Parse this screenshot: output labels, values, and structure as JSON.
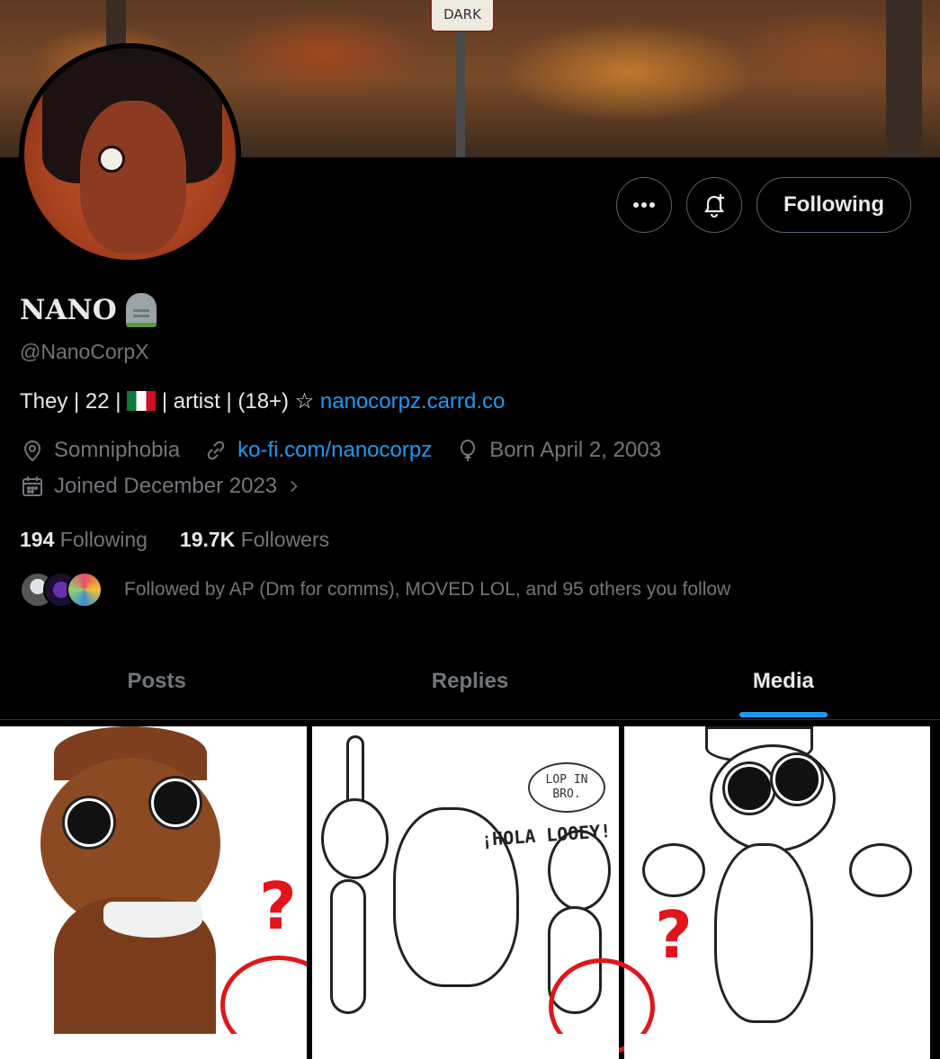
{
  "banner": {
    "sign_text": "DARK"
  },
  "actions": {
    "more_label": "•••",
    "notify_label": "Notifications",
    "follow_label": "Following"
  },
  "profile": {
    "name": "NANO",
    "name_emoji": "headstone",
    "handle": "@NanoCorpX",
    "bio_text": "They | 22 | ",
    "bio_flag": "Mexico flag",
    "bio_rest": " | artist | (18+) ☆ ",
    "bio_link": "nanocorpz.carrd.co",
    "location": "Somniphobia",
    "website": "ko-fi.com/nanocorpz",
    "birthday": "Born April 2, 2003",
    "joined": "Joined December 2023",
    "following_count": "194",
    "following_label": "Following",
    "followers_count": "19.7K",
    "followers_label": "Followers",
    "followed_by": "Followed by AP (Dm for comms), MOVED LOL, and 95 others you follow"
  },
  "tabs": [
    {
      "label": "Posts",
      "active": false
    },
    {
      "label": "Replies",
      "active": false
    },
    {
      "label": "Media",
      "active": true
    }
  ],
  "media": {
    "speech_bubble": "LOP IN BRO.",
    "hola_text": "¡HOLA LOOEY!",
    "question_mark": "?"
  },
  "colors": {
    "accent": "#1d9bf0",
    "text_primary": "#e7e9ea",
    "text_secondary": "#71767b",
    "annotation_red": "#e0161b"
  }
}
